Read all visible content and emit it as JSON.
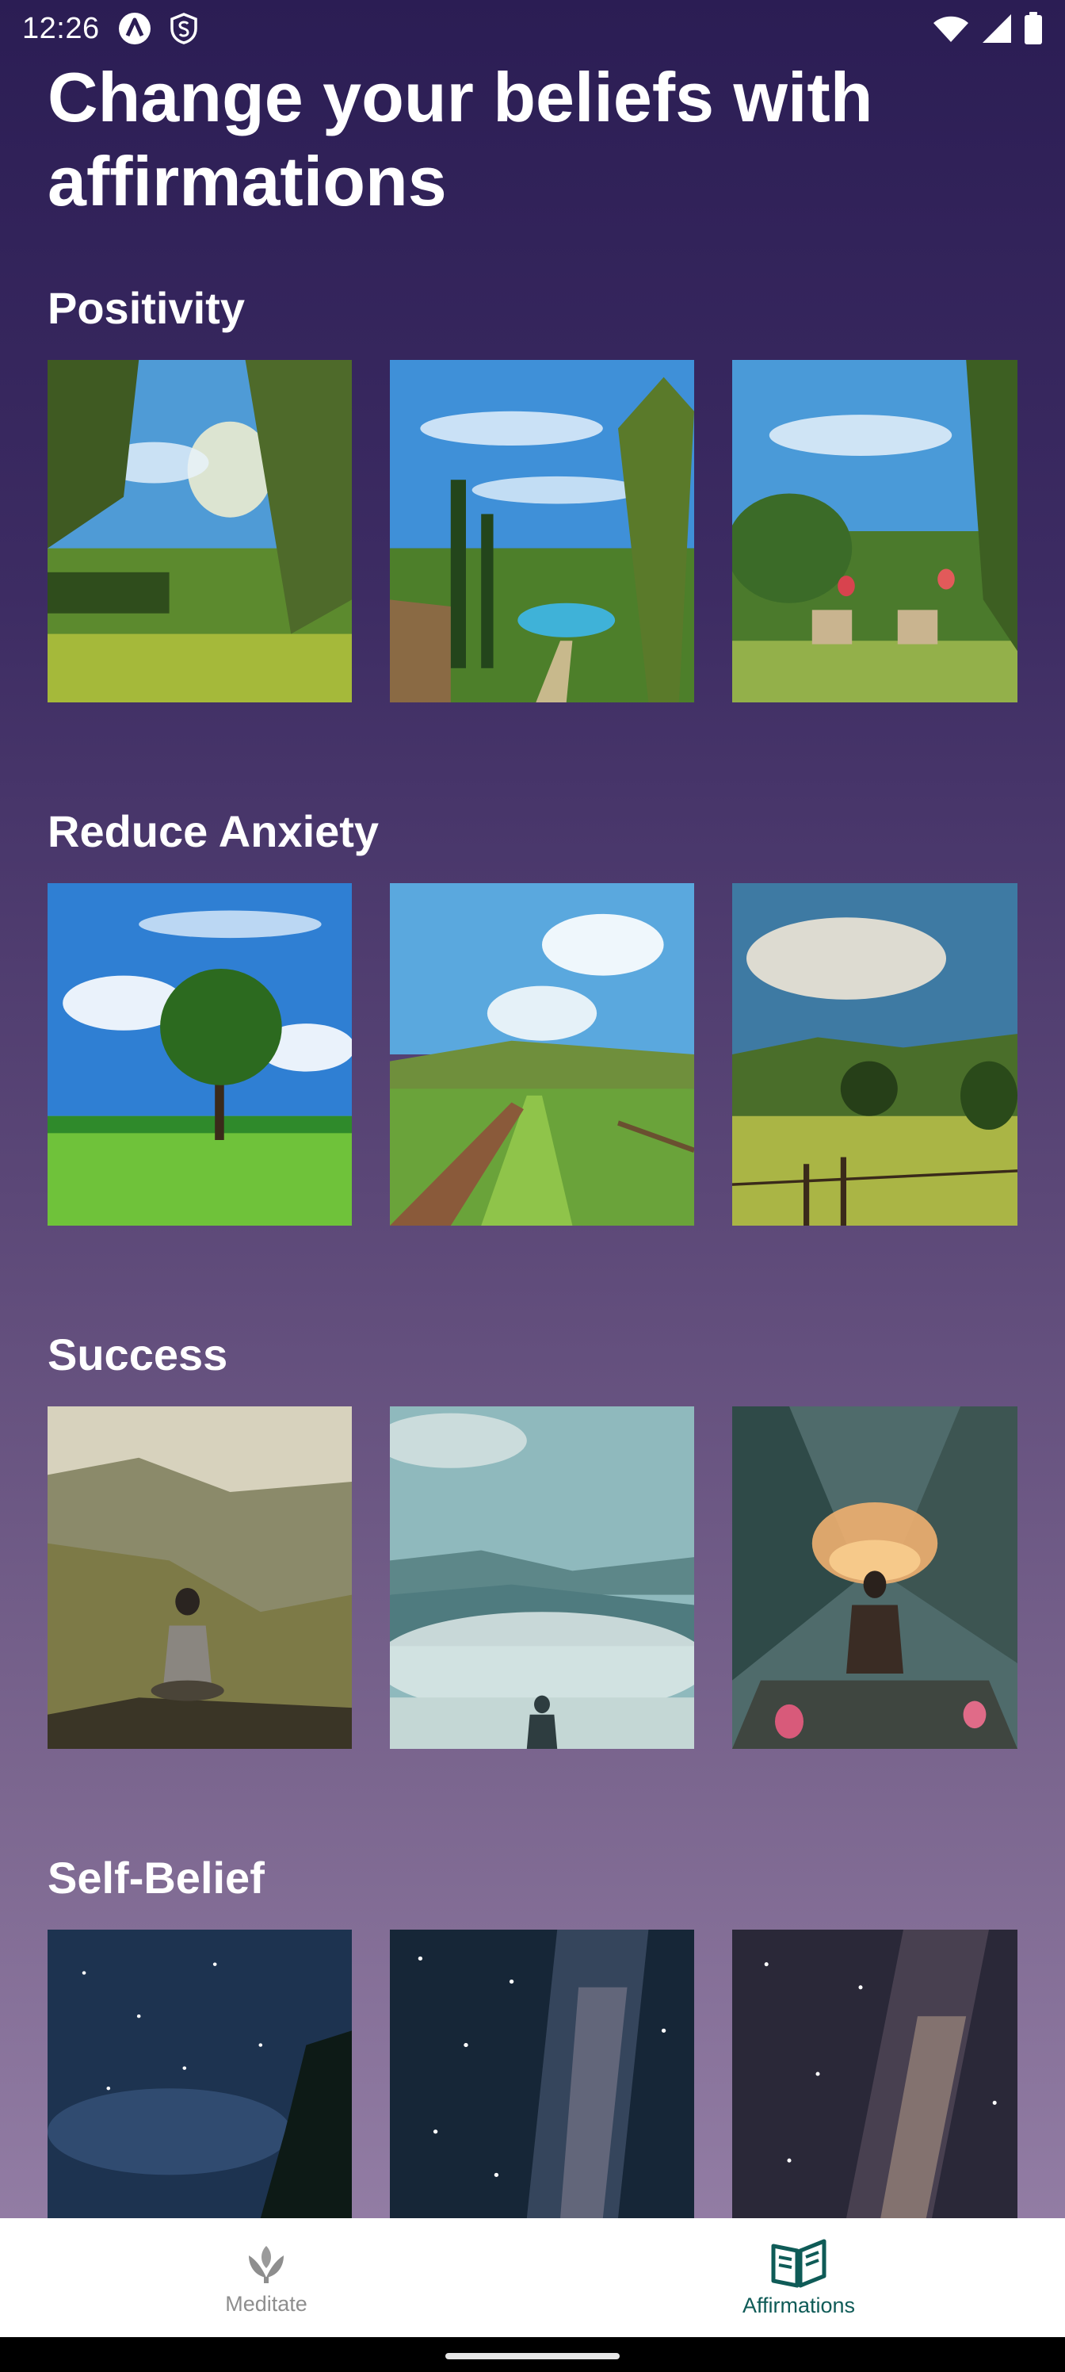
{
  "status_bar": {
    "time": "12:26",
    "icons": [
      "app-a-icon",
      "shield-s-icon",
      "wifi-icon",
      "signal-icon",
      "battery-icon"
    ]
  },
  "page": {
    "title": "Change your beliefs with affirmations"
  },
  "sections": [
    {
      "title": "Positivity",
      "images": [
        "sunny-garden-trees",
        "garden-pool-palms",
        "garden-patio-chairs"
      ]
    },
    {
      "title": "Reduce Anxiety",
      "images": [
        "lone-tree-meadow",
        "countryside-path",
        "rolling-hills-fence"
      ]
    },
    {
      "title": "Success",
      "images": [
        "meditator-mountain-ledge",
        "silhouette-above-clouds",
        "meditator-lake-sunset"
      ]
    },
    {
      "title": "Self-Belief",
      "images": [
        "night-sky-trees",
        "milky-way-stars",
        "milky-way-galaxy"
      ]
    }
  ],
  "bottom_nav": {
    "items": [
      {
        "label": "Meditate",
        "icon": "lotus-icon",
        "active": false
      },
      {
        "label": "Affirmations",
        "icon": "open-book-icon",
        "active": true
      }
    ]
  },
  "colors": {
    "background_top": "#2b1d54",
    "background_bottom": "#9a84ab",
    "active_nav": "#0f5b57",
    "inactive_nav": "#8e8e8e"
  }
}
